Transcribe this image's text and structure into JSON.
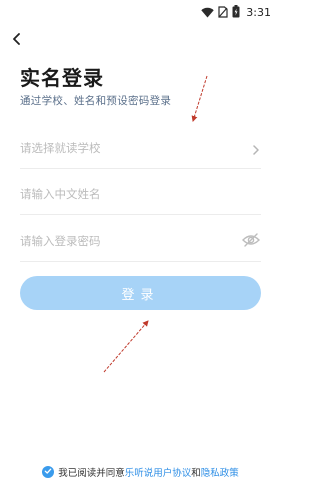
{
  "status_bar": {
    "time": "3:31"
  },
  "header": {
    "title": "实名登录",
    "subtitle": "通过学校、姓名和预设密码登录"
  },
  "form": {
    "school_placeholder": "请选择就读学校",
    "name_placeholder": "请输入中文姓名",
    "password_placeholder": "请输入登录密码",
    "school_value": "",
    "name_value": "",
    "password_value": ""
  },
  "login_button": {
    "label": "登录"
  },
  "agreement": {
    "text": "我已阅读并同意",
    "user_agreement_link": "乐听说用户协议",
    "conjunction": "和",
    "privacy_link": "隐私政策",
    "checked": true
  },
  "colors": {
    "accent": "#3a9bec",
    "button_bg": "#a7d3f7",
    "link": "#2d8ee6",
    "annotation_arrow": "#c0392b"
  },
  "icons": [
    "wifi-icon",
    "no-sim-icon",
    "battery-icon",
    "back-arrow-icon",
    "chevron-right-icon",
    "eye-off-icon",
    "checkmark-icon"
  ]
}
